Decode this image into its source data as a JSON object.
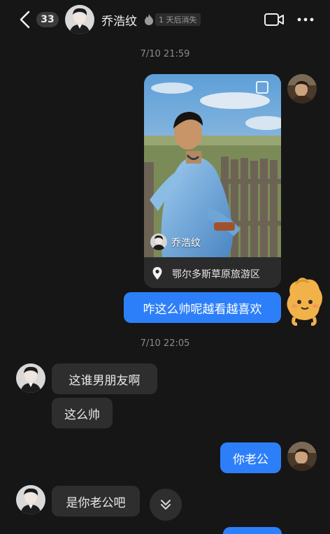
{
  "header": {
    "unread_count": "33",
    "contact_name": "乔浩纹",
    "vanish_label": "1 天后消失",
    "icons": {
      "back": "chevron-left-icon",
      "flame": "flame-icon",
      "video": "video-call-icon",
      "more": "more-dots-icon"
    }
  },
  "messages": {
    "timestamp_1": "7/10 21:59",
    "shared_post": {
      "author_name": "乔浩纹",
      "location": "鄂尔多斯草原旅游区"
    },
    "outgoing_1": "咋这么帅呢越看越喜欢",
    "timestamp_2": "7/10 22:05",
    "incoming_1": "这谁男朋友啊",
    "incoming_2": "这么帅",
    "outgoing_2": "你老公",
    "incoming_3": "是你老公吧"
  },
  "colors": {
    "background": "#161616",
    "outgoing_bubble": "#2d7ff9",
    "incoming_bubble": "#2e2e2e"
  }
}
